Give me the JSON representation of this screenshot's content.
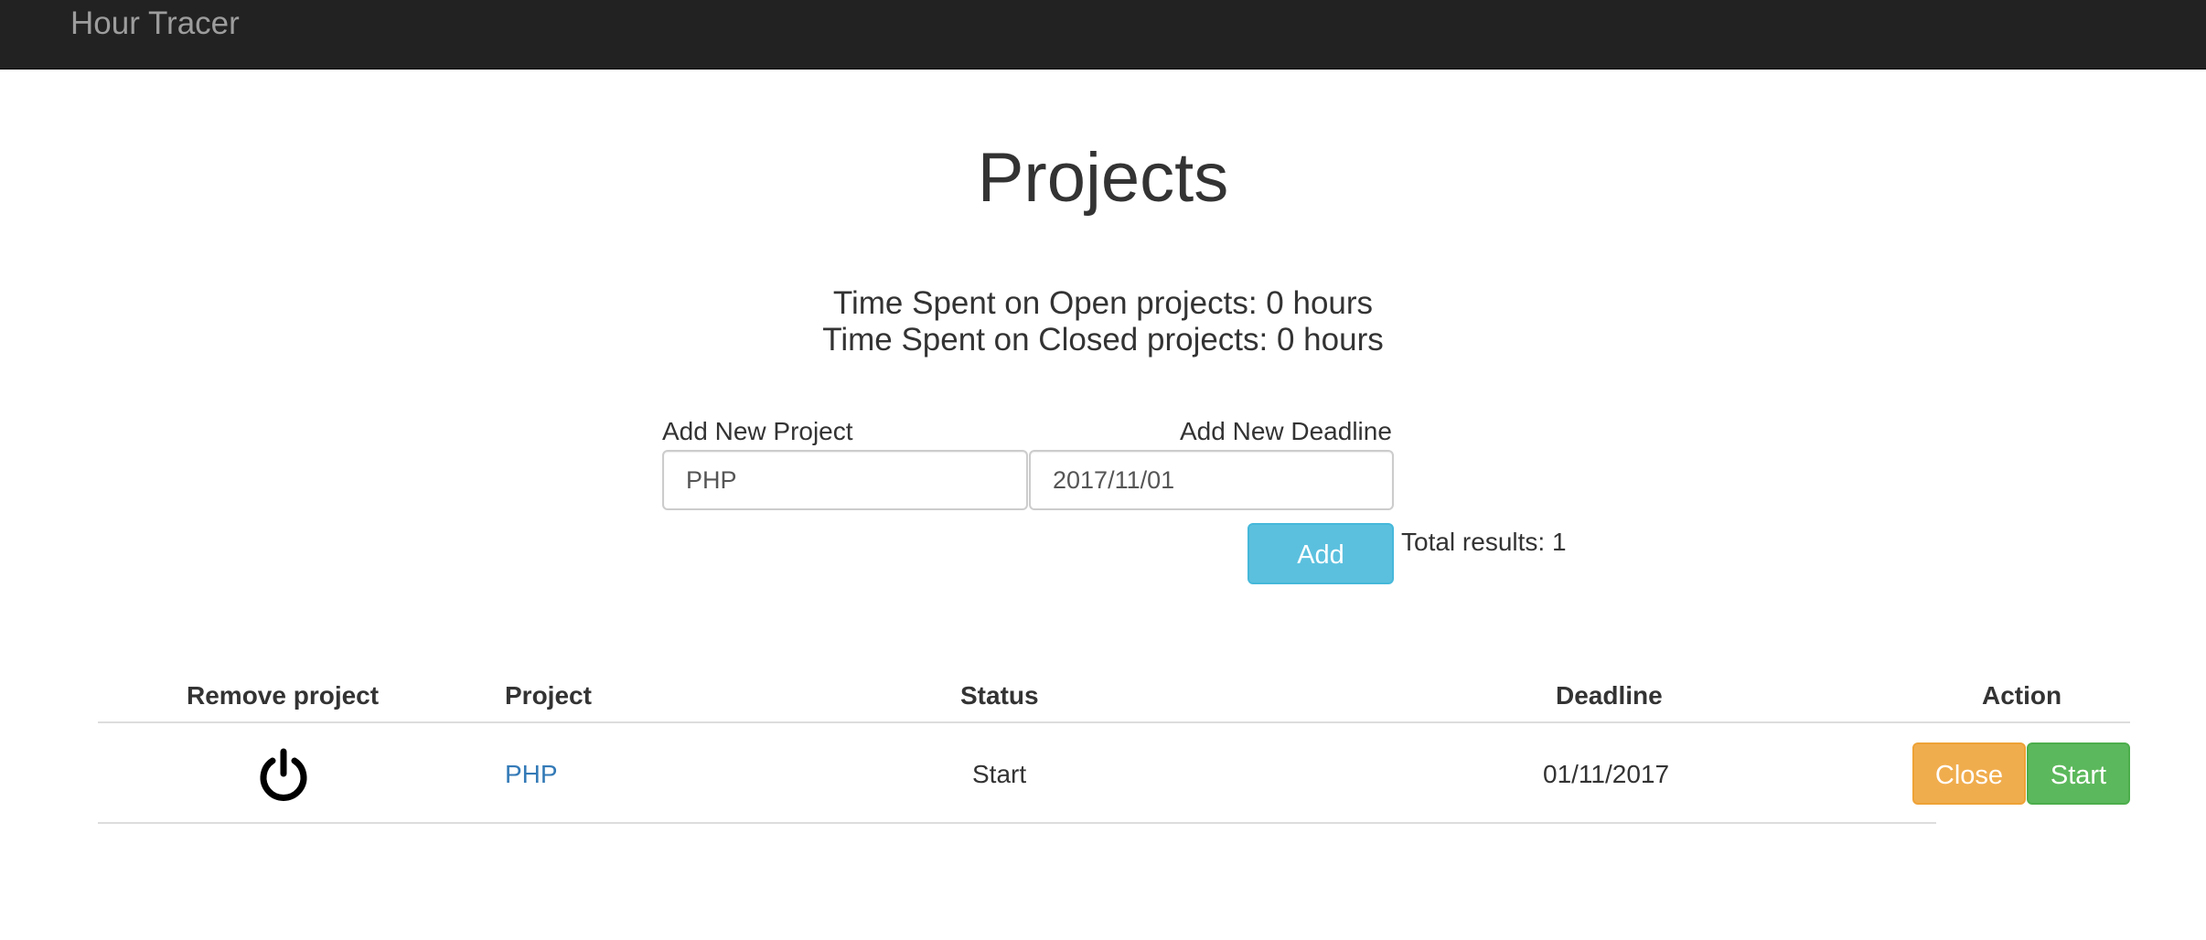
{
  "navbar": {
    "brand": "Hour Tracer"
  },
  "page": {
    "title": "Projects",
    "open_summary": "Time Spent on Open projects: 0 hours",
    "closed_summary": "Time Spent on Closed projects: 0 hours"
  },
  "form": {
    "project_label": "Add New Project",
    "project_value": "PHP",
    "deadline_label": "Add New Deadline",
    "deadline_value": "2017/11/01",
    "add_button": "Add",
    "total_results": "Total results: 1"
  },
  "table": {
    "columns": [
      "Remove project",
      "Project",
      "Status",
      "Deadline",
      "Action"
    ],
    "rows": [
      {
        "remove_icon": "power-icon",
        "project": "PHP",
        "status": "Start",
        "deadline": "01/11/2017",
        "actions": [
          "Close",
          "Start"
        ]
      }
    ]
  },
  "colors": {
    "navbar": "#222222",
    "brand": "#9d9d9d",
    "info_button": "#5bc0de",
    "warning_button": "#f0ad4e",
    "success_button": "#5cb85c",
    "link": "#337ab7"
  }
}
